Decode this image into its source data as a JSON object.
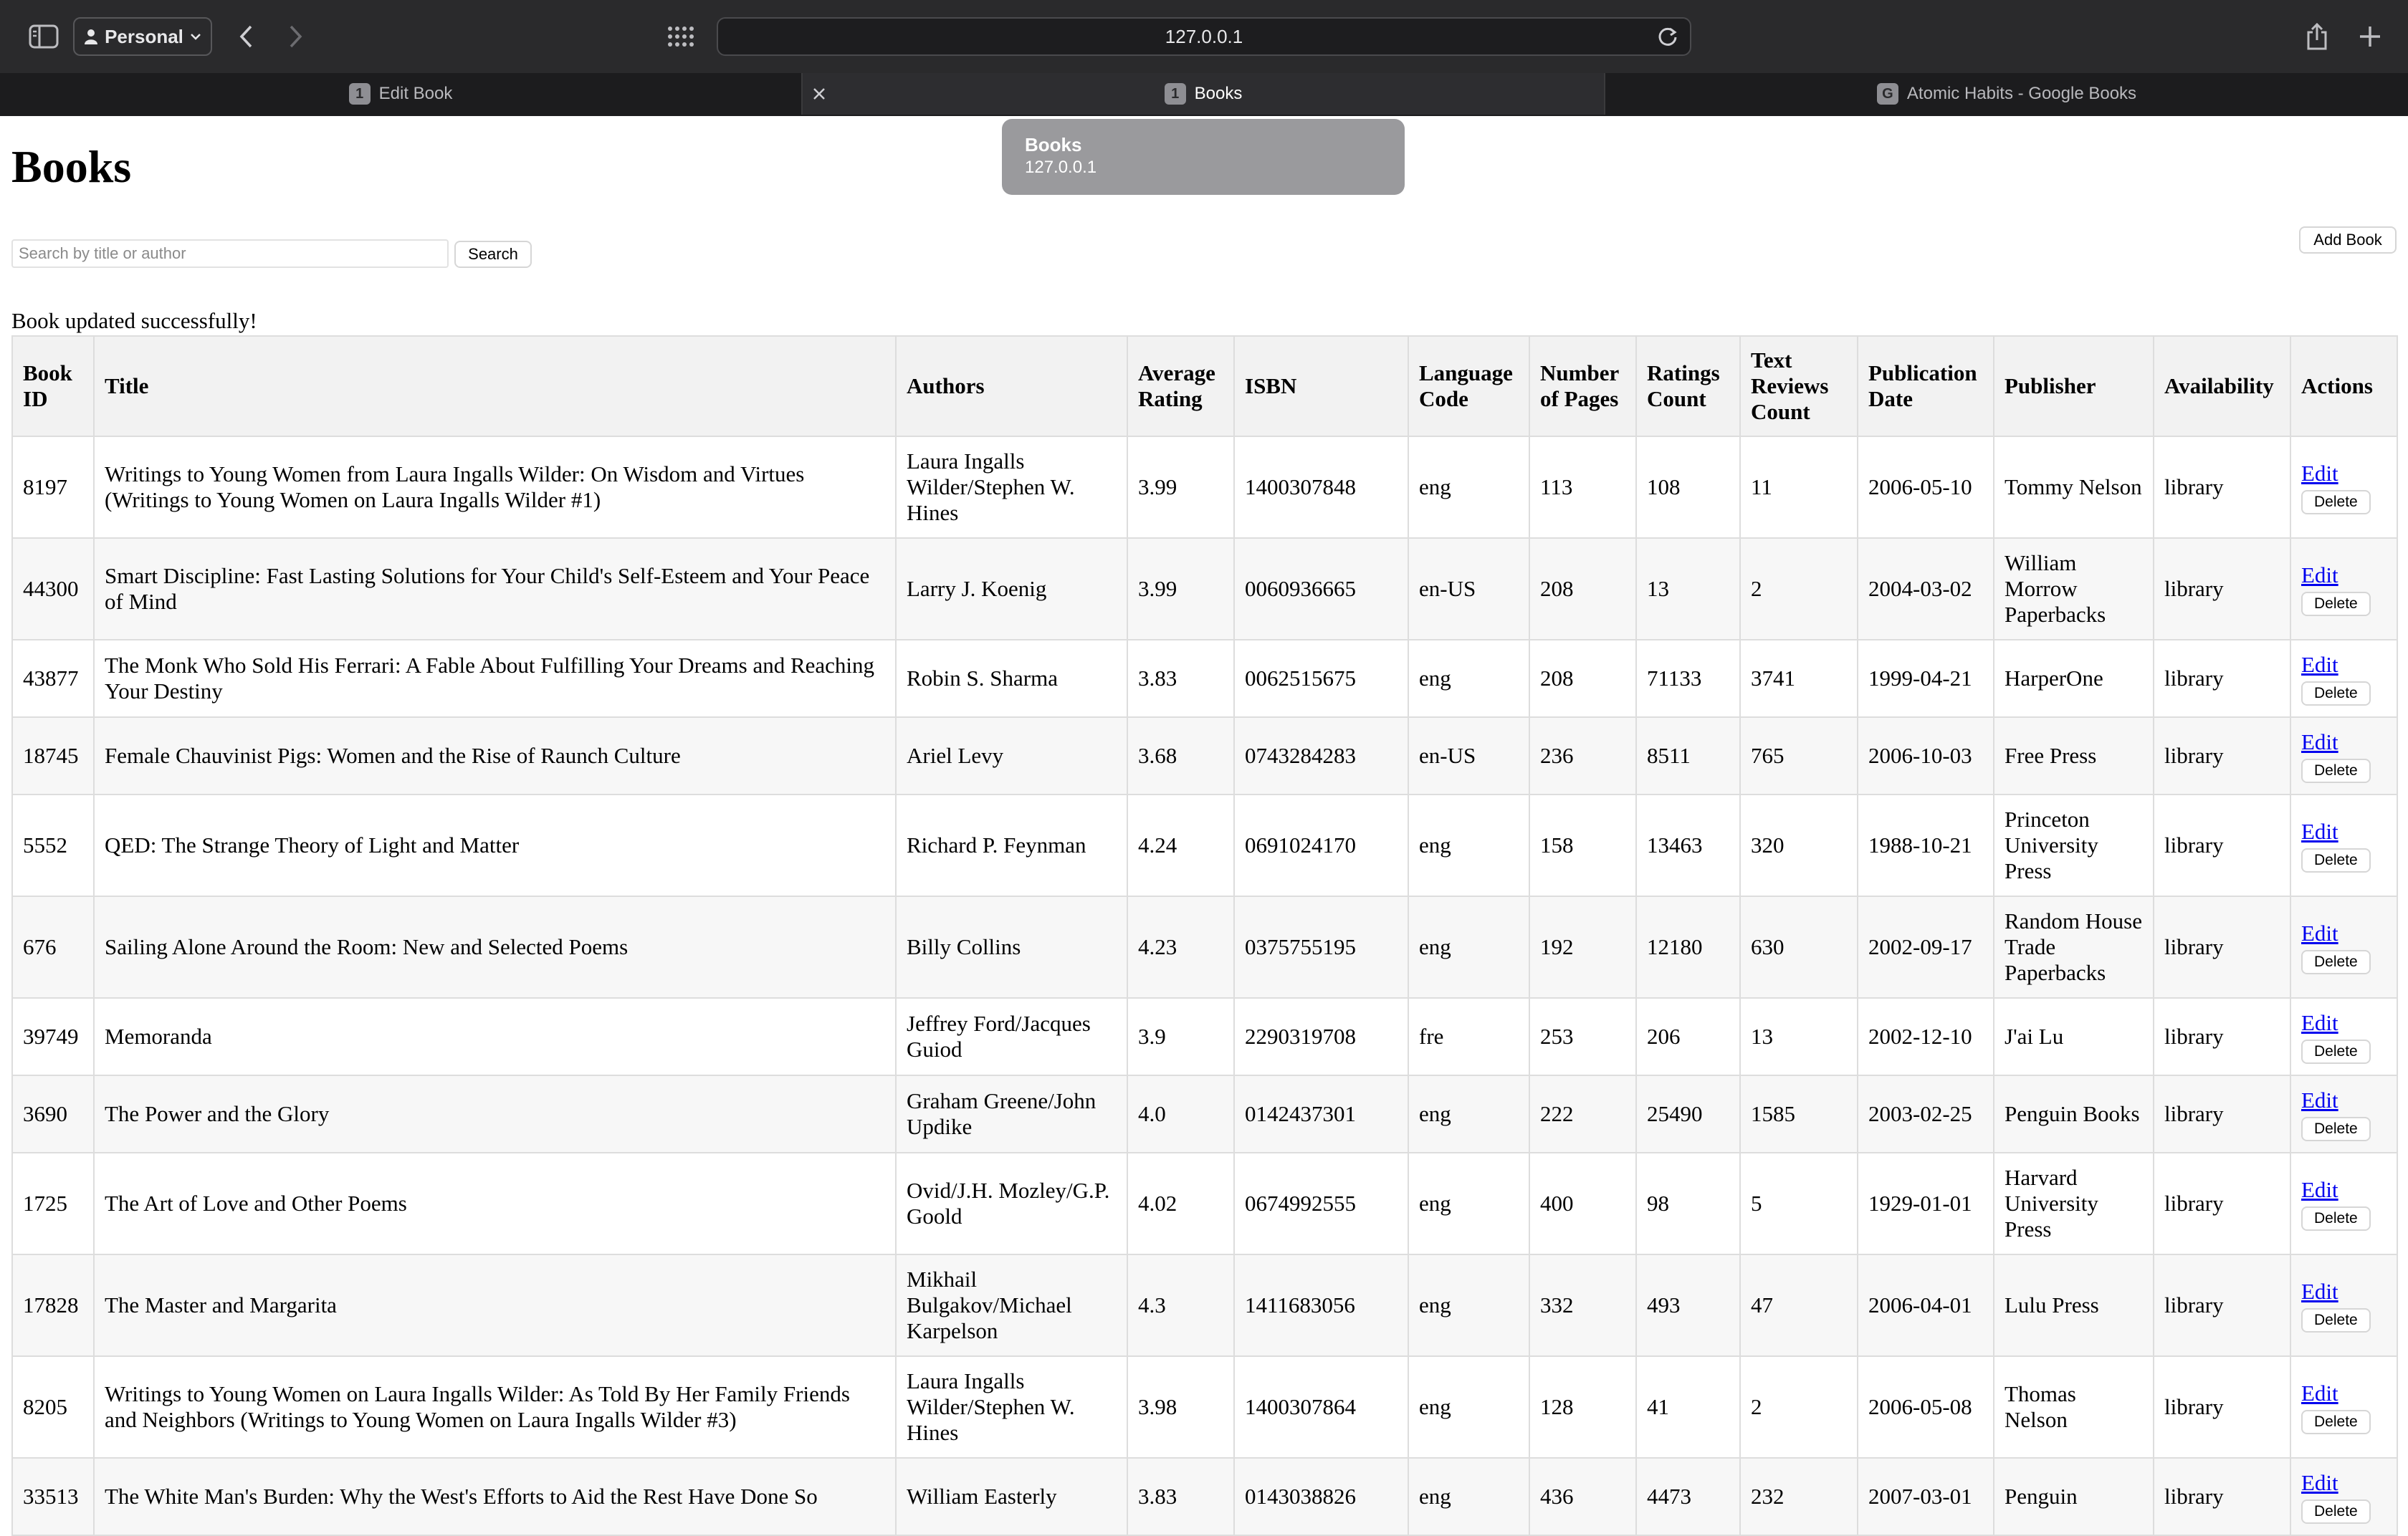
{
  "browser": {
    "profile_label": "Personal",
    "address": "127.0.0.1",
    "tabs": [
      {
        "label": "Edit Book",
        "favicon": "1",
        "active": false
      },
      {
        "label": "Books",
        "favicon": "1",
        "active": true
      },
      {
        "label": "Atomic Habits - Google Books",
        "favicon": "G",
        "active": false
      }
    ],
    "tooltip": {
      "title": "Books",
      "url": "127.0.0.1"
    }
  },
  "page": {
    "title": "Books",
    "search_placeholder": "Search by title or author",
    "search_value": "",
    "search_button": "Search",
    "add_button": "Add Book",
    "message": "Book updated successfully!"
  },
  "table": {
    "headers": [
      "Book ID",
      "Title",
      "Authors",
      "Average Rating",
      "ISBN",
      "Language Code",
      "Number of Pages",
      "Ratings Count",
      "Text Reviews Count",
      "Publication Date",
      "Publisher",
      "Availability",
      "Actions"
    ],
    "edit_label": "Edit",
    "delete_label": "Delete",
    "rows": [
      [
        "8197",
        "Writings to Young Women from Laura Ingalls Wilder: On Wisdom and Virtues (Writings to Young Women on Laura Ingalls Wilder #1)",
        "Laura Ingalls Wilder/Stephen W. Hines",
        "3.99",
        "1400307848",
        "eng",
        "113",
        "108",
        "11",
        "2006-05-10",
        "Tommy Nelson",
        "library"
      ],
      [
        "44300",
        "Smart Discipline: Fast Lasting Solutions for Your Child's Self-Esteem and Your Peace of Mind",
        "Larry J. Koenig",
        "3.99",
        "0060936665",
        "en-US",
        "208",
        "13",
        "2",
        "2004-03-02",
        "William Morrow Paperbacks",
        "library"
      ],
      [
        "43877",
        "The Monk Who Sold His Ferrari: A Fable About Fulfilling Your Dreams and Reaching Your Destiny",
        "Robin S. Sharma",
        "3.83",
        "0062515675",
        "eng",
        "208",
        "71133",
        "3741",
        "1999-04-21",
        "HarperOne",
        "library"
      ],
      [
        "18745",
        "Female Chauvinist Pigs: Women and the Rise of Raunch Culture",
        "Ariel Levy",
        "3.68",
        "0743284283",
        "en-US",
        "236",
        "8511",
        "765",
        "2006-10-03",
        "Free Press",
        "library"
      ],
      [
        "5552",
        "QED: The Strange Theory of Light and Matter",
        "Richard P. Feynman",
        "4.24",
        "0691024170",
        "eng",
        "158",
        "13463",
        "320",
        "1988-10-21",
        "Princeton University Press",
        "library"
      ],
      [
        "676",
        "Sailing Alone Around the Room: New and Selected Poems",
        "Billy Collins",
        "4.23",
        "0375755195",
        "eng",
        "192",
        "12180",
        "630",
        "2002-09-17",
        "Random House Trade Paperbacks",
        "library"
      ],
      [
        "39749",
        "Memoranda",
        "Jeffrey Ford/Jacques Guiod",
        "3.9",
        "2290319708",
        "fre",
        "253",
        "206",
        "13",
        "2002-12-10",
        "J'ai Lu",
        "library"
      ],
      [
        "3690",
        "The Power and the Glory",
        "Graham Greene/John Updike",
        "4.0",
        "0142437301",
        "eng",
        "222",
        "25490",
        "1585",
        "2003-02-25",
        "Penguin Books",
        "library"
      ],
      [
        "1725",
        "The Art of Love and Other Poems",
        "Ovid/J.H. Mozley/G.P. Goold",
        "4.02",
        "0674992555",
        "eng",
        "400",
        "98",
        "5",
        "1929-01-01",
        "Harvard University Press",
        "library"
      ],
      [
        "17828",
        "The Master and Margarita",
        "Mikhail Bulgakov/Michael Karpelson",
        "4.3",
        "1411683056",
        "eng",
        "332",
        "493",
        "47",
        "2006-04-01",
        "Lulu Press",
        "library"
      ],
      [
        "8205",
        "Writings to Young Women on Laura Ingalls Wilder: As Told By Her Family Friends and Neighbors (Writings to Young Women on Laura Ingalls Wilder #3)",
        "Laura Ingalls Wilder/Stephen W. Hines",
        "3.98",
        "1400307864",
        "eng",
        "128",
        "41",
        "2",
        "2006-05-08",
        "Thomas Nelson",
        "library"
      ],
      [
        "33513",
        "The White Man's Burden: Why the West's Efforts to Aid the Rest Have Done So",
        "William Easterly",
        "3.83",
        "0143038826",
        "eng",
        "436",
        "4473",
        "232",
        "2007-03-01",
        "Penguin",
        "library"
      ]
    ]
  }
}
